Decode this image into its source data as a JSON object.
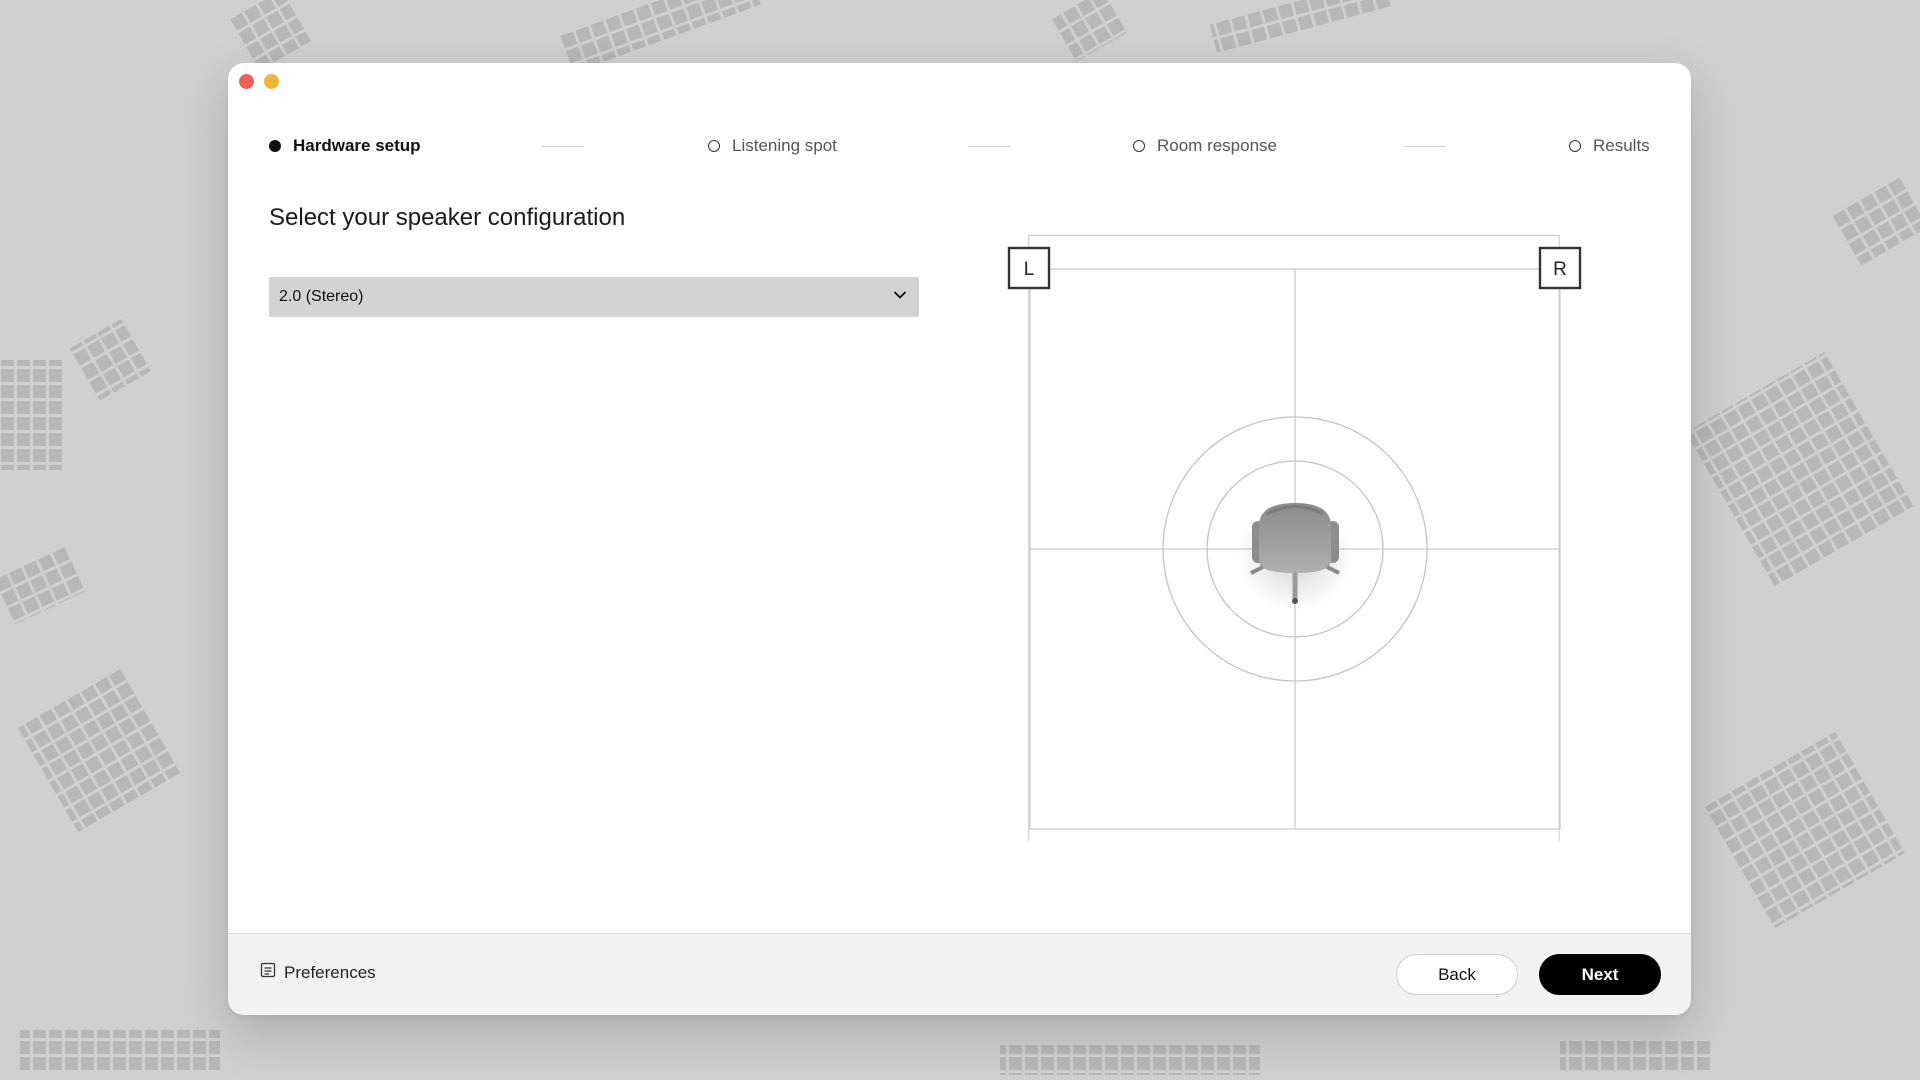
{
  "steps": [
    {
      "label": "Hardware setup",
      "state": "active"
    },
    {
      "label": "Listening spot",
      "state": "pending"
    },
    {
      "label": "Room response",
      "state": "pending"
    },
    {
      "label": "Results",
      "state": "pending"
    }
  ],
  "config": {
    "title": "Select your speaker configuration",
    "selected": "2.0 (Stereo)"
  },
  "stage": {
    "left_label": "L",
    "right_label": "R"
  },
  "footer": {
    "preferences": "Preferences",
    "back": "Back",
    "next": "Next"
  },
  "colors": {
    "accent": "#000000",
    "traffic_close": "#ee5f57",
    "traffic_minimize": "#f0b43a",
    "select_bg": "#d2d3d5"
  },
  "icons": {
    "preferences": "list-icon",
    "dropdown": "chevron-down-icon",
    "listener": "chair-icon"
  }
}
